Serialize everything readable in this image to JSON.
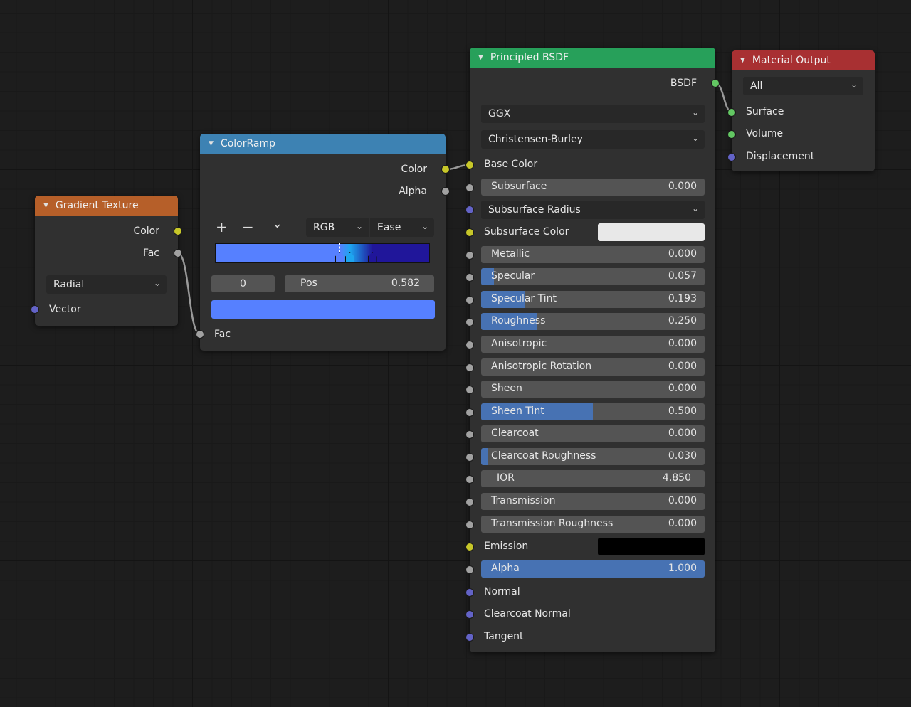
{
  "colors": {
    "gradient_header": "#b65f29",
    "colorramp_header": "#3d82b3",
    "bsdf_header": "#27a05a",
    "output_header": "#a83032",
    "accent": "#4772b3"
  },
  "gradient_texture": {
    "title": "Gradient Texture",
    "out_color": "Color",
    "out_fac": "Fac",
    "type": "Radial",
    "in_vector": "Vector"
  },
  "color_ramp": {
    "title": "ColorRamp",
    "out_color": "Color",
    "out_alpha": "Alpha",
    "add_icon": "+",
    "remove_icon": "−",
    "menu_icon": "⌄",
    "color_mode": "RGB",
    "interpolation": "Ease",
    "stop_index": "0",
    "pos_label": "Pos",
    "pos_value": "0.582",
    "active_color": "#5680ff",
    "stops": [
      {
        "position": 0.582,
        "color": "#5680ff"
      },
      {
        "position": 0.63,
        "color": "#1ea5ef"
      },
      {
        "position": 0.735,
        "color": "#20169a"
      }
    ],
    "in_fac": "Fac"
  },
  "principled_bsdf": {
    "title": "Principled BSDF",
    "out_bsdf": "BSDF",
    "distribution": "GGX",
    "subsurface_method": "Christensen-Burley",
    "base_color": "Base Color",
    "subsurface": {
      "label": "Subsurface",
      "value": "0.000",
      "fraction": 0
    },
    "subsurface_radius": "Subsurface Radius",
    "subsurface_color": {
      "label": "Subsurface Color",
      "color": "#e8e8e8"
    },
    "metallic": {
      "label": "Metallic",
      "value": "0.000",
      "fraction": 0
    },
    "specular": {
      "label": "Specular",
      "value": "0.057",
      "fraction": 0.057
    },
    "specular_tint": {
      "label": "Specular Tint",
      "value": "0.193",
      "fraction": 0.193
    },
    "roughness": {
      "label": "Roughness",
      "value": "0.250",
      "fraction": 0.25
    },
    "anisotropic": {
      "label": "Anisotropic",
      "value": "0.000",
      "fraction": 0
    },
    "anisotropic_rotation": {
      "label": "Anisotropic Rotation",
      "value": "0.000",
      "fraction": 0
    },
    "sheen": {
      "label": "Sheen",
      "value": "0.000",
      "fraction": 0
    },
    "sheen_tint": {
      "label": "Sheen Tint",
      "value": "0.500",
      "fraction": 0.5
    },
    "clearcoat": {
      "label": "Clearcoat",
      "value": "0.000",
      "fraction": 0
    },
    "clearcoat_roughness": {
      "label": "Clearcoat Roughness",
      "value": "0.030",
      "fraction": 0.03
    },
    "ior": {
      "label": "IOR",
      "value": "4.850",
      "fraction": 0
    },
    "transmission": {
      "label": "Transmission",
      "value": "0.000",
      "fraction": 0
    },
    "transmission_roughness": {
      "label": "Transmission Roughness",
      "value": "0.000",
      "fraction": 0
    },
    "emission": {
      "label": "Emission",
      "color": "#000000"
    },
    "alpha": {
      "label": "Alpha",
      "value": "1.000",
      "fraction": 1
    },
    "normal": "Normal",
    "clearcoat_normal": "Clearcoat Normal",
    "tangent": "Tangent"
  },
  "material_output": {
    "title": "Material Output",
    "target": "All",
    "surface": "Surface",
    "volume": "Volume",
    "displacement": "Displacement"
  }
}
